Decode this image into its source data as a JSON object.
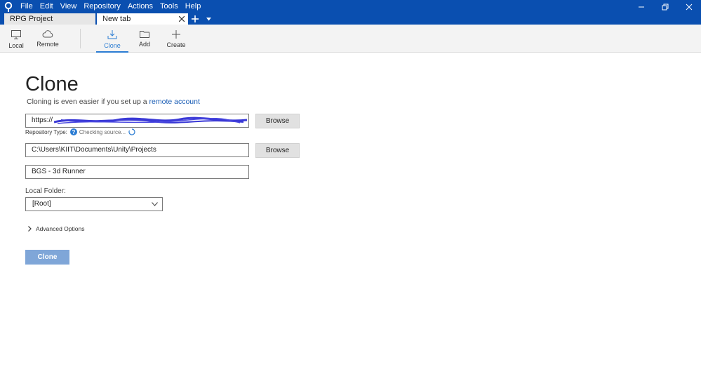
{
  "menu": [
    "File",
    "Edit",
    "View",
    "Repository",
    "Actions",
    "Tools",
    "Help"
  ],
  "tabs": [
    {
      "label": "RPG Project"
    },
    {
      "label": "New tab"
    }
  ],
  "toolbar": {
    "local": "Local",
    "remote": "Remote",
    "clone": "Clone",
    "add": "Add",
    "create": "Create"
  },
  "main": {
    "title": "Clone",
    "subtitle_prefix": "Cloning is even easier if you set up a ",
    "subtitle_link": "remote account",
    "url_value": "https://",
    "browse_label": "Browse",
    "repo_type_label": "Repository Type:",
    "repo_type_status": "Checking source...",
    "destination_path": "C:\\Users\\KIIT\\Documents\\Unity\\Projects",
    "repo_name": "BGS - 3d Runner",
    "local_folder_label": "Local Folder:",
    "local_folder_value": "[Root]",
    "advanced_options": "Advanced Options",
    "clone_button": "Clone"
  },
  "colors": {
    "titlebar": "#0a4fb0",
    "accent": "#2b7cd3",
    "link": "#1a5db5",
    "clone_button": "#7fa6d8"
  },
  "icons": {
    "app": "sourcetree-logo-icon",
    "local": "monitor-icon",
    "remote": "cloud-icon",
    "clone": "download-icon",
    "add": "folder-icon",
    "create": "plus-icon"
  }
}
